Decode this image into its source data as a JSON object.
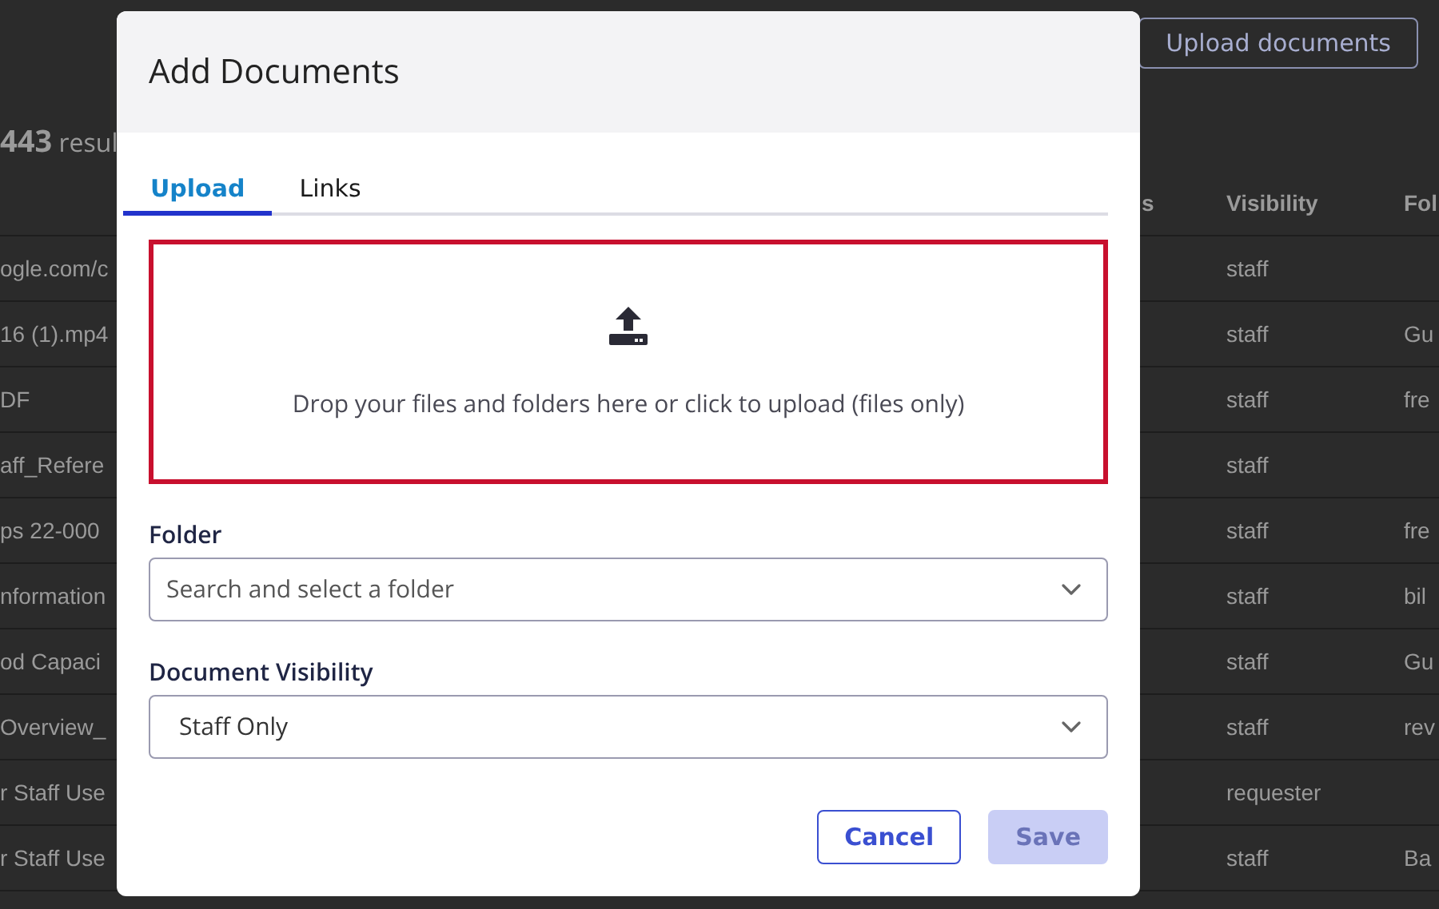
{
  "page": {
    "toolbar_button": "Upload documents",
    "results_count": "**443** resul",
    "table": {
      "columns": [
        "s",
        "Visibility",
        "Fol"
      ],
      "rows": [
        {
          "name": "ogle.com/c",
          "visibility": "staff"
        },
        {
          "name": "16 (1).mp4",
          "visibility": "staff",
          "folder": "Gu"
        },
        {
          "name": "DF",
          "visibility": "staff",
          "folder": "fre"
        },
        {
          "name": "aff_Refere",
          "visibility": "staff"
        },
        {
          "name": "ps 22-000",
          "visibility": "staff",
          "folder": "fre"
        },
        {
          "name": "nformation",
          "visibility": "staff",
          "folder": "bil"
        },
        {
          "name": "od Capaci",
          "visibility": "staff",
          "folder": "Gu"
        },
        {
          "name": "Overview_",
          "visibility": "staff",
          "folder": "rev"
        },
        {
          "name": "r Staff Use",
          "visibility": "requester"
        },
        {
          "name": "r Staff Use",
          "visibility": "staff",
          "folder": "Ba"
        }
      ]
    }
  },
  "dialog": {
    "title": "Add Documents",
    "tabs": [
      {
        "label": "Upload",
        "selected": true
      },
      {
        "label": "Links",
        "selected": false
      }
    ],
    "dropzone": {
      "text": "Drop your files and folders here or click to upload (files only)"
    },
    "fields": [
      {
        "label": "Folder",
        "placeholder": "Search and select a folder"
      },
      {
        "label": "Document Visibility",
        "value": "Staff Only"
      }
    ],
    "buttons": [
      {
        "label": "Cancel",
        "kind": "secondary",
        "disabled": false
      },
      {
        "label": "Save",
        "kind": "primary",
        "disabled": true
      }
    ]
  }
}
